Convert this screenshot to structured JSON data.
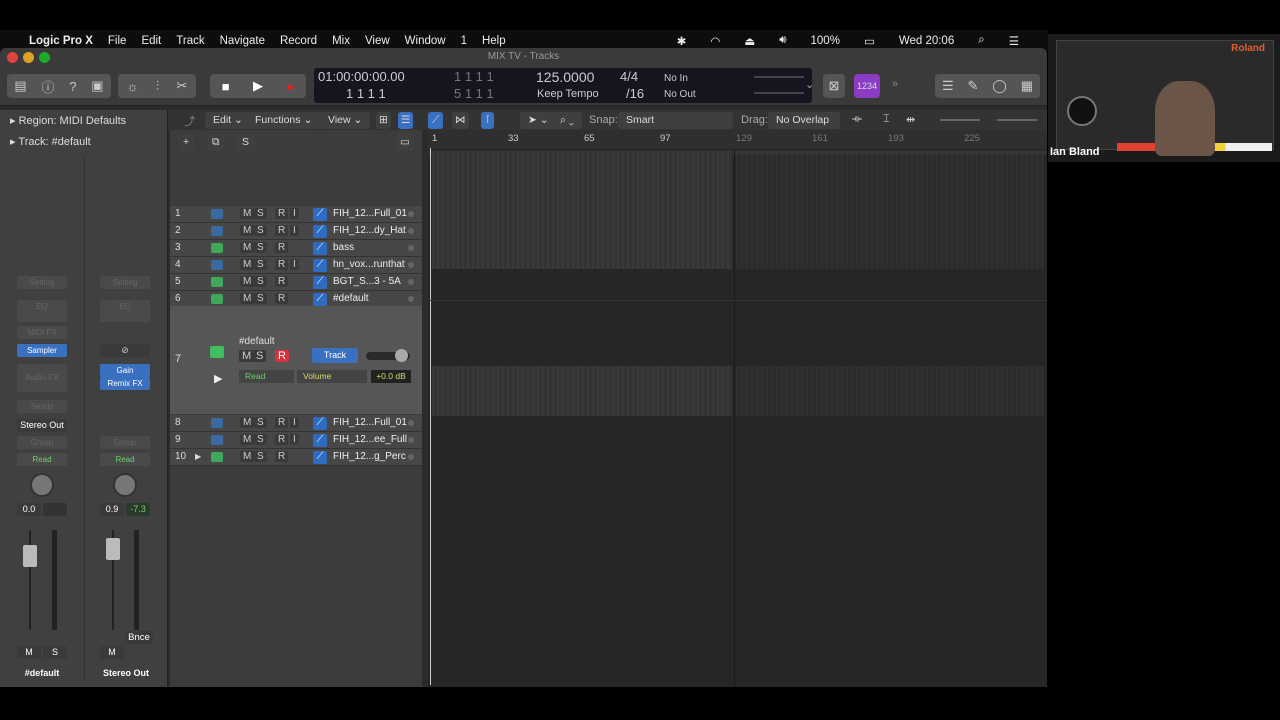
{
  "menubar": {
    "app": "Logic Pro X",
    "items": [
      "File",
      "Edit",
      "Track",
      "Navigate",
      "Record",
      "Mix",
      "View",
      "Window",
      "1",
      "Help"
    ],
    "battery": "100%",
    "clock": "Wed 20:06"
  },
  "window": {
    "title": "MIX TV - Tracks"
  },
  "lcd": {
    "smpte": "01:00:00:00.00",
    "bars": "1  1  1     1",
    "loc1": "1  1  1     1",
    "loc2": "5  1  1     1",
    "tempo": "125.0000",
    "tempo_mode": "Keep Tempo",
    "sig": "4/4",
    "div": "/16",
    "in": "No In",
    "out": "No Out"
  },
  "toolbar": {
    "count_in": "1234"
  },
  "sub": {
    "edit": "Edit",
    "functions": "Functions",
    "view": "View",
    "snap_label": "Snap:",
    "snap": "Smart",
    "drag_label": "Drag:",
    "drag": "No Overlap"
  },
  "ruler": [
    "1",
    "33",
    "65",
    "97",
    "129",
    "161",
    "193",
    "225"
  ],
  "inspector": {
    "region": "Region: MIDI Defaults",
    "track": "Track:  #default",
    "strip1": {
      "setting": "Setting",
      "eq": "EQ",
      "midifx": "MIDI FX",
      "inst": "Sampler",
      "audiofx": "Audio FX",
      "sends": "Sends",
      "output": "Stereo Out",
      "group": "Group",
      "auto": "Read",
      "pan": "0.0",
      "m": "M",
      "s": "S",
      "name": "#default"
    },
    "strip2": {
      "setting": "Setting",
      "eq": "EQ",
      "fx1": "Gain",
      "fx2": "Remix FX",
      "group": "Group",
      "auto": "Read",
      "pan": "0.9",
      "peak": "-7.3",
      "bnce": "Bnce",
      "m": "M",
      "name": "Stereo Out"
    }
  },
  "tracks": [
    {
      "n": "1",
      "name": "FIH_12...Full_01",
      "i": true
    },
    {
      "n": "2",
      "name": "FIH_12...dy_Hat",
      "i": true
    },
    {
      "n": "3",
      "name": "bass",
      "i": false
    },
    {
      "n": "4",
      "name": "hn_vox...runthat",
      "i": true
    },
    {
      "n": "5",
      "name": "BGT_S...3 - 5A",
      "i": false
    },
    {
      "n": "6",
      "name": "#default",
      "i": false
    },
    {
      "n": "8",
      "name": "FIH_12...Full_01",
      "i": true
    },
    {
      "n": "9",
      "name": "FIH_12...ee_Full",
      "i": true
    },
    {
      "n": "10",
      "name": "FIH_12...g_Perc",
      "i": false
    }
  ],
  "selected_track": {
    "n": "7",
    "name": "#default",
    "m": "M",
    "s": "S",
    "r": "R",
    "track_btn": "Track",
    "auto": "Read",
    "param": "Volume",
    "value": "+0.0 dB"
  },
  "buttons": {
    "m": "M",
    "s": "S",
    "r": "R",
    "i": "I",
    "add": "+",
    "solo": "S"
  },
  "webcam": {
    "name": "Ian Bland"
  }
}
